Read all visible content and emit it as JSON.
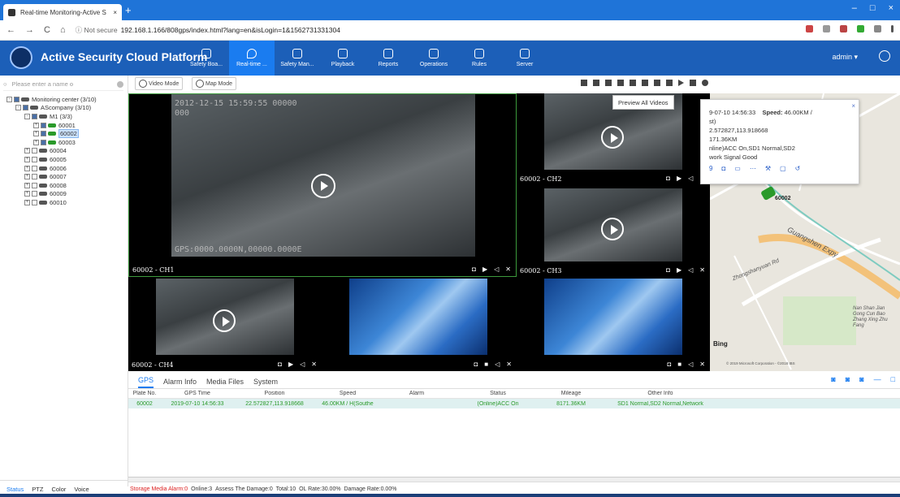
{
  "browser": {
    "tab_title": "Real-time Monitoring-Active S",
    "tab_close": "×",
    "new_tab": "+",
    "window_controls": [
      "–",
      "□",
      "×"
    ],
    "not_secure": "ⓘ Not secure",
    "url": "192.168.1.166/808gps/index.html?lang=en&isLogin=1&1562731331304",
    "nav": [
      "←",
      "→",
      "C",
      "⌂"
    ]
  },
  "app": {
    "title": "Active Security Cloud Platform",
    "user": "admin ▾",
    "nav": [
      {
        "label": "Safety Boa...",
        "active": false
      },
      {
        "label": "Real-time ...",
        "active": true
      },
      {
        "label": "Safety Man...",
        "active": false
      },
      {
        "label": "Playback",
        "active": false
      },
      {
        "label": "Reports",
        "active": false
      },
      {
        "label": "Operations",
        "active": false
      },
      {
        "label": "Rules",
        "active": false
      },
      {
        "label": "Server",
        "active": false
      }
    ]
  },
  "left": {
    "search_placeholder": "Please enter a name o",
    "tree": [
      {
        "label": "Monitoring center (3/10)",
        "indent": 0,
        "pm": "-",
        "type": "root"
      },
      {
        "label": "AScompany (3/10)",
        "indent": 1,
        "pm": "-",
        "type": "company"
      },
      {
        "label": "M1 (3/3)",
        "indent": 2,
        "pm": "-",
        "type": "group"
      },
      {
        "label": "60001",
        "indent": 3,
        "pm": "+",
        "type": "dev-on"
      },
      {
        "label": "60002",
        "indent": 3,
        "pm": "+",
        "type": "dev-on",
        "selected": true
      },
      {
        "label": "60003",
        "indent": 3,
        "pm": "+",
        "type": "dev-on"
      },
      {
        "label": "60004",
        "indent": 2,
        "pm": "+",
        "type": "dev"
      },
      {
        "label": "60005",
        "indent": 2,
        "pm": "+",
        "type": "dev"
      },
      {
        "label": "60006",
        "indent": 2,
        "pm": "+",
        "type": "dev"
      },
      {
        "label": "60007",
        "indent": 2,
        "pm": "+",
        "type": "dev"
      },
      {
        "label": "60008",
        "indent": 2,
        "pm": "+",
        "type": "dev"
      },
      {
        "label": "60009",
        "indent": 2,
        "pm": "+",
        "type": "dev"
      },
      {
        "label": "60010",
        "indent": 2,
        "pm": "+",
        "type": "dev"
      }
    ],
    "bottom_tabs": [
      "Status",
      "PTZ",
      "Color",
      "Voice"
    ]
  },
  "toolbar": {
    "video_mode": "Video Mode",
    "map_mode": "Map Mode",
    "tooltip": "Preview All Videos"
  },
  "videos": {
    "ch1": "60002 - CH1",
    "ch2": "60002 - CH2",
    "ch3": "60002 - CH3",
    "ch4": "60002 - CH4",
    "osd_top": "2012-12-15 15:59:55      00000",
    "osd_top2": "000",
    "osd_bottom": "GPS:0000.0000N,00000.0000E"
  },
  "popup": {
    "line1": "9-07-10 14:56:33",
    "speed_label": "Speed:",
    "speed_value": "46.00KM /",
    "line2": "st)",
    "line3": "2.572827,113.918668",
    "line4": "171.36KM",
    "line5": "nline)ACC On,SD1 Normal,SD2",
    "line6": "work Signal Good",
    "close": "×"
  },
  "map": {
    "marker_label": "60002",
    "roads": [
      "Guangshen Expy",
      "Zhongshanyuan Rd",
      "Nan Shan Jian Gong Cun Bao Zhang Xing Zhu Fang"
    ],
    "bing": "Bing",
    "copyright": "© 2019 Microsoft Corporation - ©2018 IBS"
  },
  "bottom": {
    "tabs": [
      {
        "label": "GPS",
        "active": true
      },
      {
        "label": "Alarm Info",
        "active": false
      },
      {
        "label": "Media Files",
        "active": false
      },
      {
        "label": "System",
        "active": false
      }
    ],
    "columns": [
      "Plate No.",
      "GPS Time",
      "Position",
      "Speed",
      "Alarm",
      "Status",
      "Mileage",
      "Other Info"
    ],
    "rows": [
      [
        "60002",
        "2019-07-10 14:56:33",
        "22.572827,113.918668",
        "46.00KM / H(Southe",
        "",
        "(Online)ACC On",
        "8171.36KM",
        "SD1 Normal,SD2 Normal,Network"
      ]
    ]
  },
  "status": {
    "storage": "Storage Media Alarm:0",
    "online": "Online:3",
    "damage": "Assess The Damage:0",
    "total": "Total:10",
    "ol_rate": "OL Rate:30.00%",
    "damage_rate": "Damage Rate:0.00%"
  }
}
